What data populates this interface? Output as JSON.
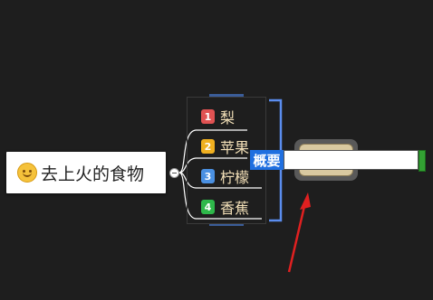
{
  "root": {
    "label": "去上火的食物",
    "icon": "smile-emoji-icon"
  },
  "children": [
    {
      "number": "1",
      "label": "梨",
      "badge_color": "#e05252"
    },
    {
      "number": "2",
      "label": "苹果",
      "badge_color": "#f0b020"
    },
    {
      "number": "3",
      "label": "柠檬",
      "badge_color": "#4a90e2"
    },
    {
      "number": "4",
      "label": "香蕉",
      "badge_color": "#2eb84a"
    }
  ],
  "summary": {
    "label": "概要",
    "input_value": ""
  },
  "colors": {
    "background": "#1e1e1e",
    "bracket": "#5b8def",
    "arrow": "#e02020",
    "text": "#f3e0b8"
  }
}
